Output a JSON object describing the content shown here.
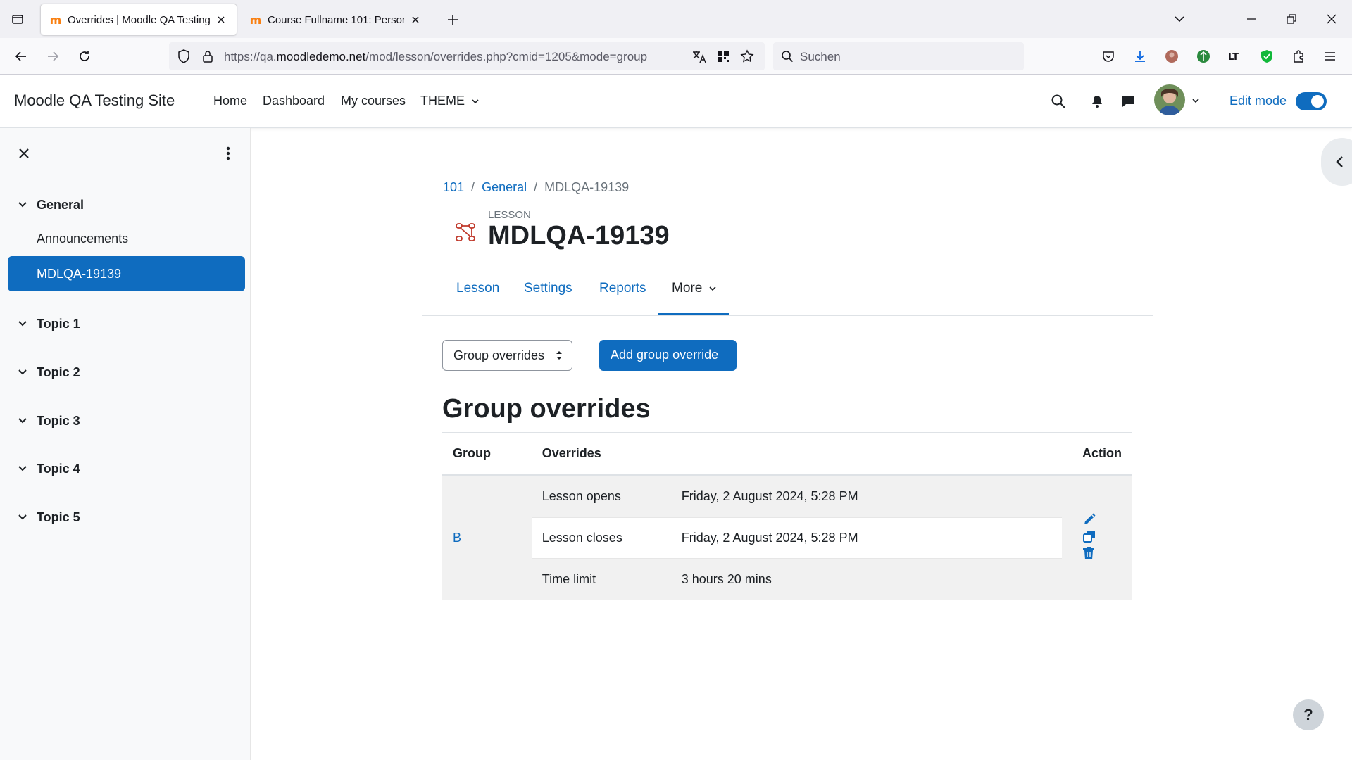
{
  "browser": {
    "tabs": [
      {
        "title": "Overrides | Moodle QA Testing Site",
        "active": true
      },
      {
        "title": "Course Fullname 101: Personal pages",
        "active": false
      }
    ],
    "url_prefix": "https://qa.",
    "url_domain": "moodledemo.net",
    "url_path": "/mod/lesson/overrides.php?cmid=1205&mode=group",
    "search_placeholder": "Suchen"
  },
  "header": {
    "site_name": "Moodle QA Testing Site",
    "nav": [
      "Home",
      "Dashboard",
      "My courses",
      "THEME"
    ],
    "edit_mode_label": "Edit mode",
    "edit_mode_on": true
  },
  "drawer": {
    "sections": [
      {
        "title": "General",
        "activities": [
          "Announcements",
          "MDLQA-19139"
        ]
      },
      {
        "title": "Topic 1"
      },
      {
        "title": "Topic 2"
      },
      {
        "title": "Topic 3"
      },
      {
        "title": "Topic 4"
      },
      {
        "title": "Topic 5"
      }
    ],
    "selected_activity": "MDLQA-19139"
  },
  "breadcrumb": [
    "101",
    "General",
    "MDLQA-19139"
  ],
  "module": {
    "type": "LESSON",
    "title": "MDLQA-19139"
  },
  "tabs": [
    "Lesson",
    "Settings",
    "Reports",
    "More"
  ],
  "active_tab": "More",
  "override_select": "Group overrides",
  "add_button": "Add group override",
  "section_title": "Group overrides",
  "table": {
    "headers": [
      "Group",
      "Overrides",
      "Action"
    ],
    "rows": [
      {
        "group": "B",
        "overrides": [
          {
            "name": "Lesson opens",
            "value": "Friday, 2 August 2024, 5:28 PM"
          },
          {
            "name": "Lesson closes",
            "value": "Friday, 2 August 2024, 5:28 PM"
          },
          {
            "name": "Time limit",
            "value": "3 hours 20 mins"
          }
        ]
      }
    ]
  },
  "help_label": "?",
  "colors": {
    "primary": "#0f6cbf",
    "text": "#1d2125",
    "drawer_bg": "#f8f9fa"
  }
}
